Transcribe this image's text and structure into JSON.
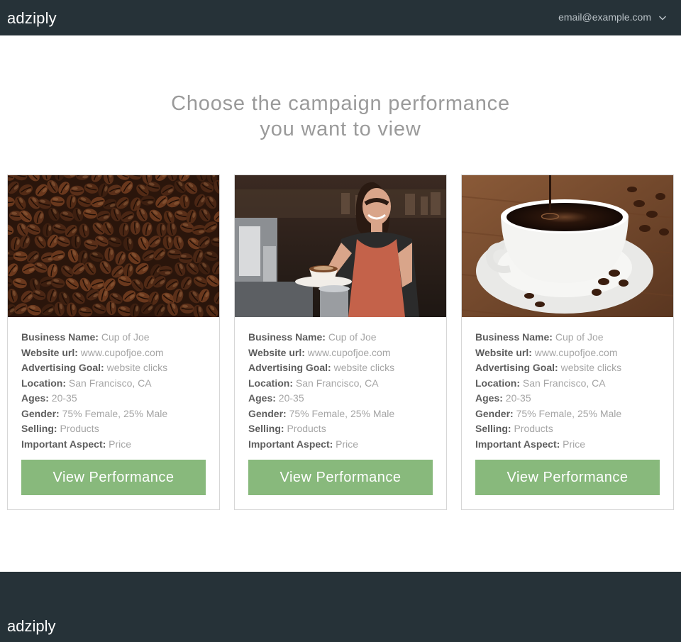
{
  "header": {
    "brand": "adziply",
    "user_email": "email@example.com"
  },
  "main": {
    "headline_line1": "Choose the campaign performance",
    "headline_line2": "you want to view"
  },
  "labels": {
    "business_name": "Business Name:",
    "website_url": "Website url:",
    "advertising_goal": "Advertising Goal:",
    "location": "Location:",
    "ages": "Ages:",
    "gender": "Gender:",
    "selling": "Selling:",
    "important_aspect": "Important Aspect:"
  },
  "campaigns": [
    {
      "image": "coffee-beans-image",
      "business_name": "Cup of Joe",
      "website_url": "www.cupofjoe.com",
      "advertising_goal": "website clicks",
      "location": "San Francisco, CA",
      "ages": "20-35",
      "gender": "75% Female, 25% Male",
      "selling": "Products",
      "important_aspect": "Price",
      "button_label": "View Performance"
    },
    {
      "image": "barista-serving-coffee-image",
      "business_name": "Cup of Joe",
      "website_url": "www.cupofjoe.com",
      "advertising_goal": "website clicks",
      "location": "San Francisco, CA",
      "ages": "20-35",
      "gender": "75% Female, 25% Male",
      "selling": "Products",
      "important_aspect": "Price",
      "button_label": "View Performance"
    },
    {
      "image": "coffee-cup-saucer-image",
      "business_name": "Cup of Joe",
      "website_url": "www.cupofjoe.com",
      "advertising_goal": "website clicks",
      "location": "San Francisco, CA",
      "ages": "20-35",
      "gender": "75% Female, 25% Male",
      "selling": "Products",
      "important_aspect": "Price",
      "button_label": "View Performance"
    }
  ],
  "footer": {
    "brand": "adziply"
  },
  "colors": {
    "nav_background": "#263238",
    "button_green": "#88b97c",
    "headline_gray": "#9a9a9a"
  }
}
